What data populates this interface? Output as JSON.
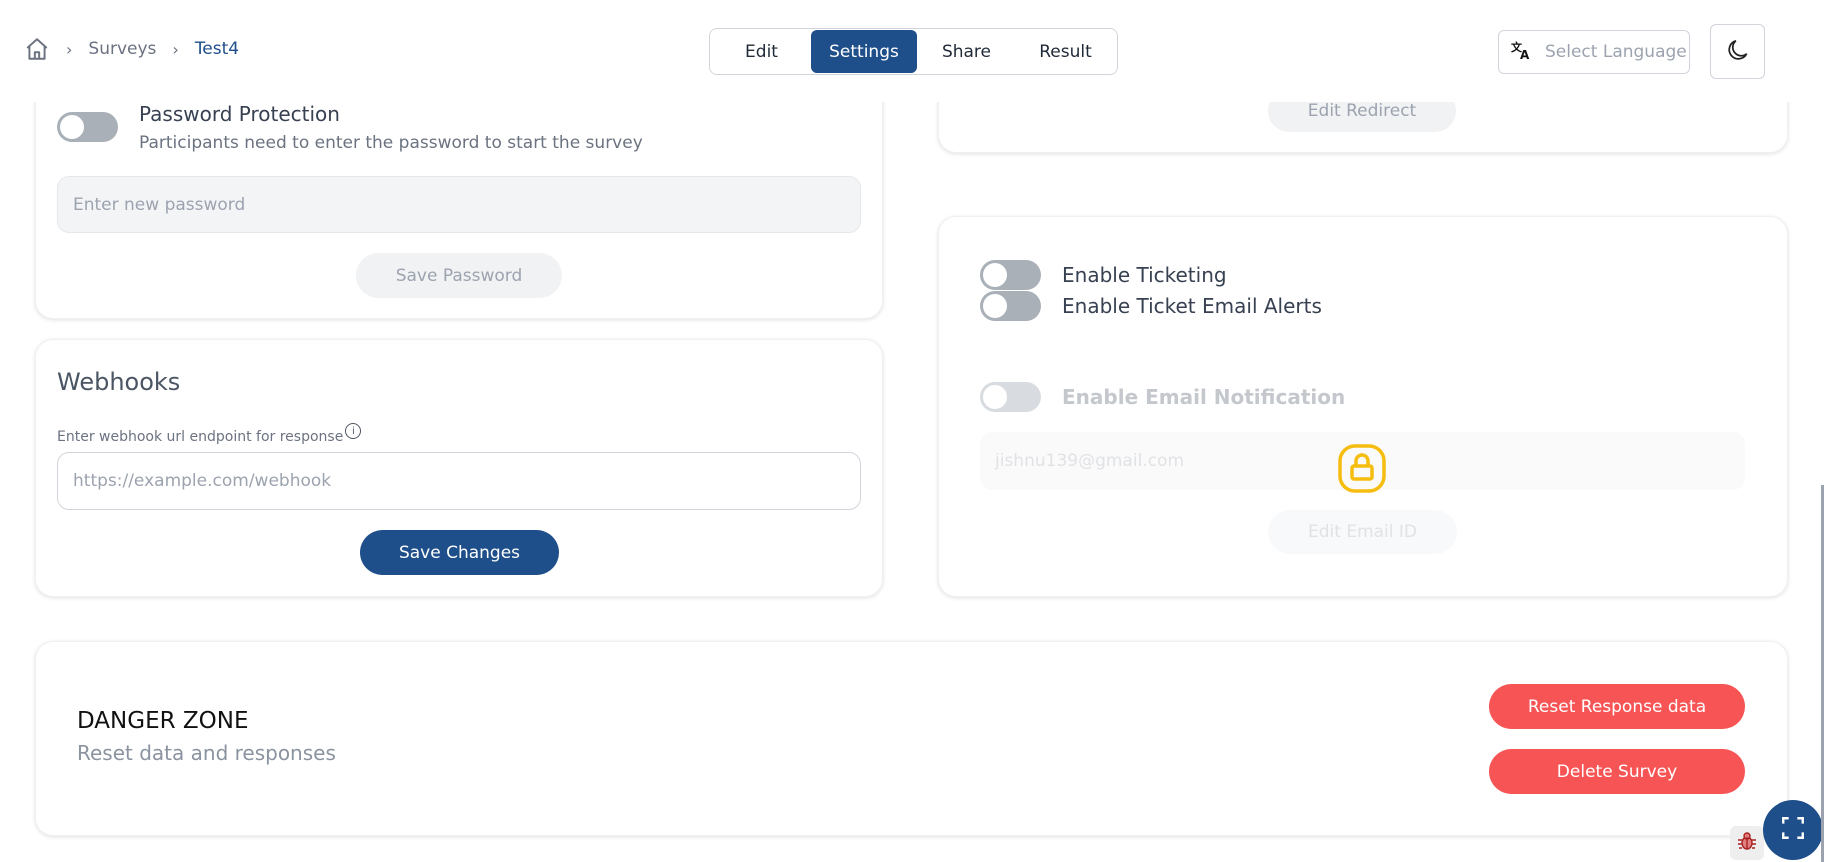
{
  "breadcrumb": {
    "home_icon": "home-icon",
    "items": [
      "Surveys",
      "Test4"
    ],
    "separator": "›"
  },
  "tabs": [
    {
      "label": "Edit",
      "active": false
    },
    {
      "label": "Settings",
      "active": true
    },
    {
      "label": "Share",
      "active": false
    },
    {
      "label": "Result",
      "active": false
    }
  ],
  "header": {
    "language_placeholder": "Select Language",
    "language_icon": "translate-icon",
    "theme_icon": "moon-icon"
  },
  "password": {
    "enabled": false,
    "title": "Password Protection",
    "description": "Participants need to enter the password to start the survey",
    "input_placeholder": "Enter new password",
    "save_label": "Save Password"
  },
  "webhooks": {
    "title": "Webhooks",
    "label": "Enter webhook url endpoint for response",
    "info_icon": "i",
    "input_placeholder": "https://example.com/webhook",
    "save_label": "Save Changes"
  },
  "redirect": {
    "edit_label": "Edit Redirect"
  },
  "ticketing": {
    "enable_ticketing": {
      "label": "Enable Ticketing",
      "enabled": false
    },
    "enable_ticket_email_alerts": {
      "label": "Enable Ticket Email Alerts",
      "enabled": false
    },
    "enable_email_notification": {
      "label": "Enable Email Notification",
      "enabled": false,
      "locked": true
    },
    "email_value": "jishnu139@gmail.com",
    "edit_email_label": "Edit Email ID"
  },
  "danger_zone": {
    "title": "DANGER ZONE",
    "description": "Reset data and responses",
    "reset_label": "Reset Response data",
    "delete_label": "Delete Survey"
  },
  "colors": {
    "primary": "#1e4f8a",
    "danger": "#f75555",
    "lock": "#f5bd0f"
  }
}
